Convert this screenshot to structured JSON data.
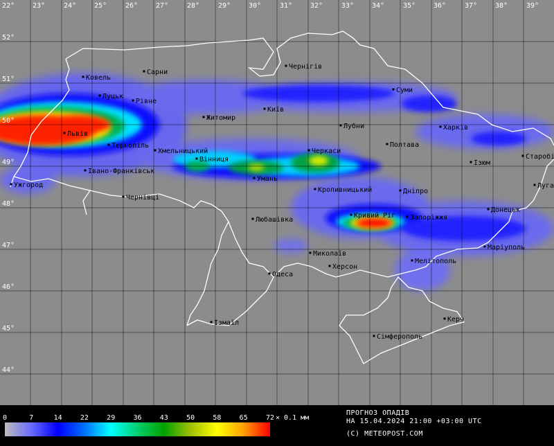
{
  "map": {
    "longitudes": [
      "22°",
      "23°",
      "24°",
      "25°",
      "26°",
      "27°",
      "28°",
      "29°",
      "30°",
      "31°",
      "32°",
      "33°",
      "34°",
      "35°",
      "36°",
      "37°",
      "38°",
      "39°"
    ],
    "latitudes": [
      "52°",
      "51°",
      "50°",
      "49°",
      "48°",
      "47°",
      "46°",
      "45°",
      "44°"
    ],
    "cities": [
      {
        "name": "Ковель"
      },
      {
        "name": "Сарни"
      },
      {
        "name": "Чернігів"
      },
      {
        "name": "Луцьк"
      },
      {
        "name": "Рівне"
      },
      {
        "name": "Суми"
      },
      {
        "name": "Київ"
      },
      {
        "name": "Житомир"
      },
      {
        "name": "Львів"
      },
      {
        "name": "Лубни"
      },
      {
        "name": "Харків"
      },
      {
        "name": "Тернопіль"
      },
      {
        "name": "Полтава"
      },
      {
        "name": "Хмельницький"
      },
      {
        "name": "Черкаси"
      },
      {
        "name": "Вінниця"
      },
      {
        "name": "Ізюм"
      },
      {
        "name": "Старобільськ"
      },
      {
        "name": "Івано-Франківськ"
      },
      {
        "name": "Умань"
      },
      {
        "name": "Ужгород"
      },
      {
        "name": "Кропивницький"
      },
      {
        "name": "Дніпро"
      },
      {
        "name": "Луганськ"
      },
      {
        "name": "Чернівці"
      },
      {
        "name": "Кривий Ріг"
      },
      {
        "name": "Донецьк"
      },
      {
        "name": "Любашівка"
      },
      {
        "name": "Запоріжжя"
      },
      {
        "name": "Маріуполь"
      },
      {
        "name": "Миколаїв"
      },
      {
        "name": "Мелітополь"
      },
      {
        "name": "Херсон"
      },
      {
        "name": "Одеса"
      },
      {
        "name": "Ізмаїл"
      },
      {
        "name": "Керч"
      },
      {
        "name": "Сімферополь"
      }
    ]
  },
  "legend": {
    "ticks": [
      "0",
      "7",
      "14",
      "22",
      "29",
      "36",
      "43",
      "50",
      "58",
      "65",
      "72"
    ],
    "unit": "× 0.1 мм",
    "colors": [
      "#bdbdbd",
      "#6a6aff",
      "#0000ff",
      "#0070ff",
      "#00ffff",
      "#00d070",
      "#00a000",
      "#a0c000",
      "#ffff00",
      "#ffa000",
      "#ff0000"
    ]
  },
  "forecast": {
    "title": "ПРОГНОЗ ОПАДІВ",
    "datetime": "НА 15.04.2024 21:00 +03:00 UTC",
    "credit": "(C) METEOPOST.COM"
  }
}
